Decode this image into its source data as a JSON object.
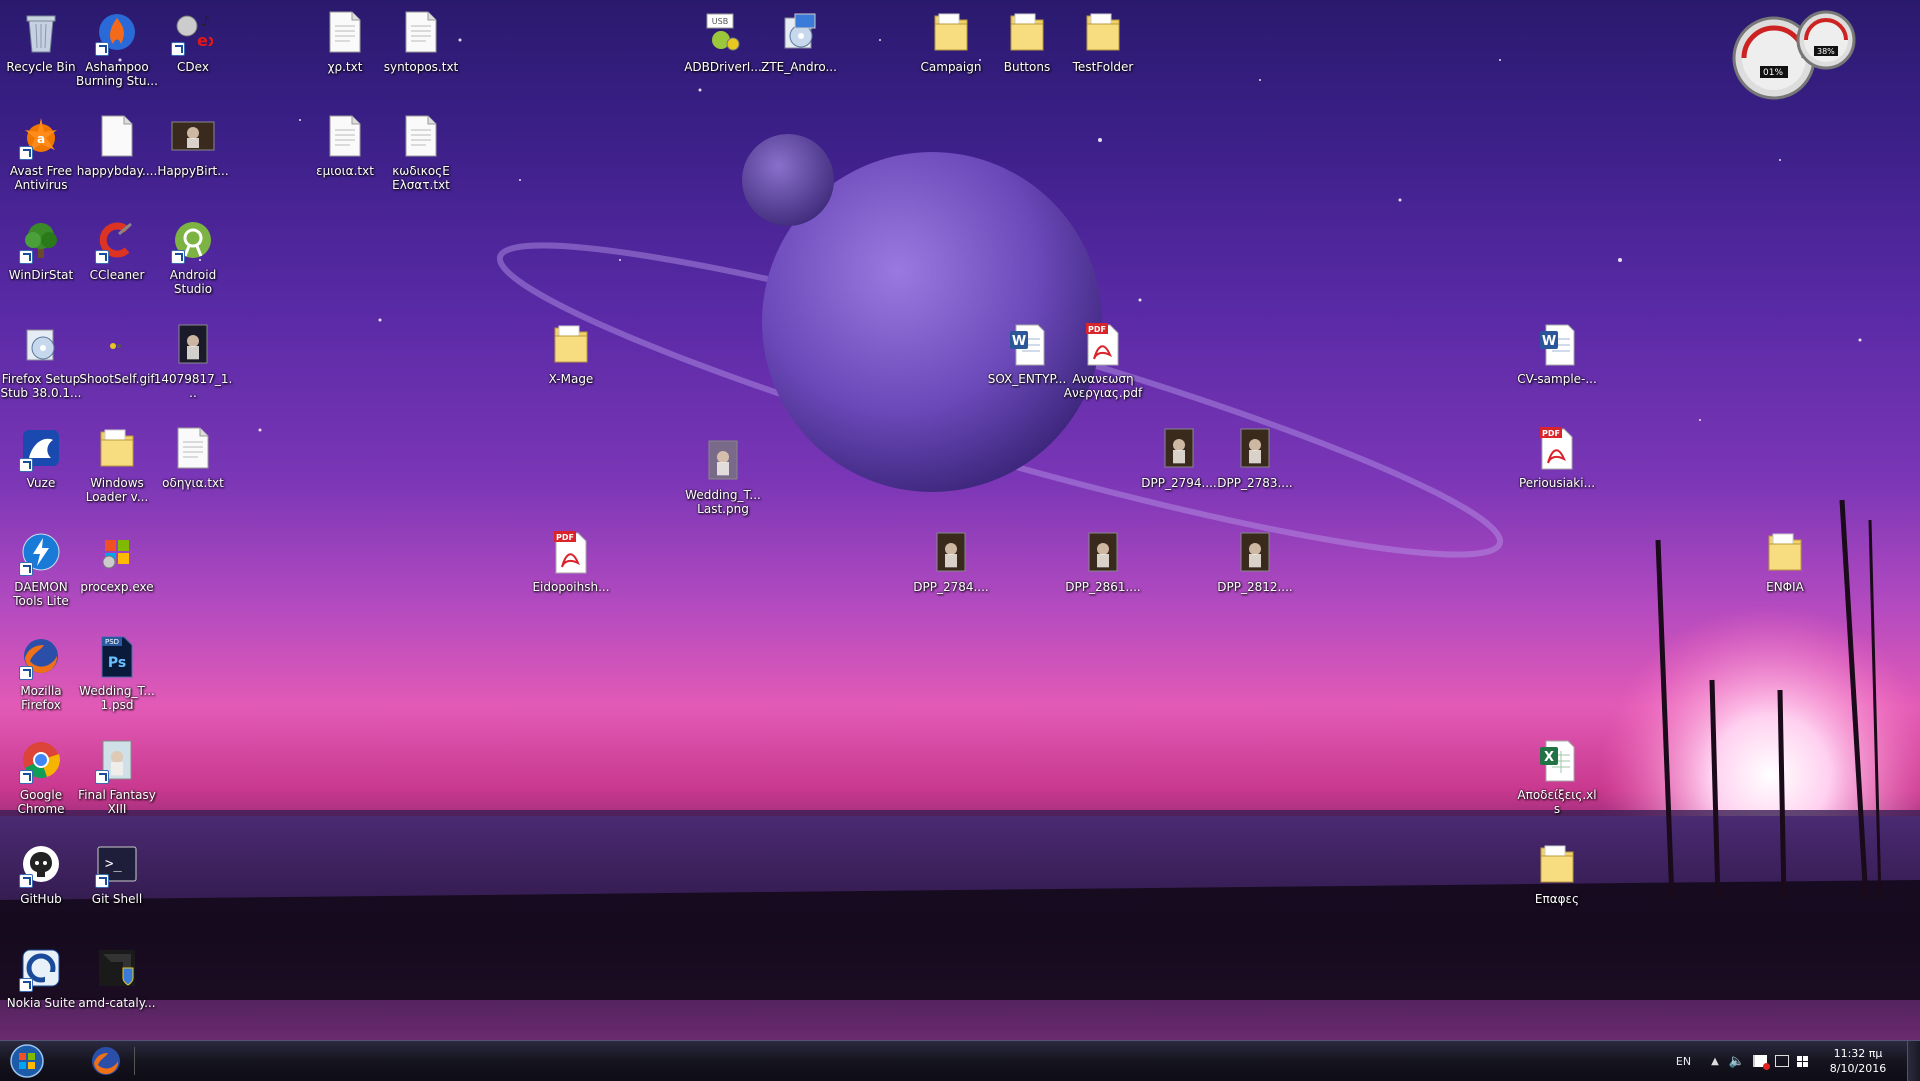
{
  "desktop": {
    "icons": [
      {
        "id": "recycle-bin",
        "label": "Recycle Bin",
        "icon": "recycle-bin-icon",
        "shortcut": false
      },
      {
        "id": "ashampoo",
        "label": "Ashampoo Burning Stu...",
        "icon": "ashampoo-flame-icon",
        "shortcut": true
      },
      {
        "id": "cdex",
        "label": "CDex",
        "icon": "cdex-icon",
        "shortcut": true
      },
      {
        "id": "xp-txt",
        "label": "χρ.txt",
        "icon": "text-file-icon",
        "shortcut": false
      },
      {
        "id": "syntopos-txt",
        "label": "syntopos.txt",
        "icon": "text-file-icon",
        "shortcut": false
      },
      {
        "id": "adbdriver",
        "label": "ADBDriverI...",
        "icon": "adb-usb-icon",
        "shortcut": false
      },
      {
        "id": "zte-android",
        "label": "ZTE_Andro...",
        "icon": "installer-icon",
        "shortcut": false
      },
      {
        "id": "campaign",
        "label": "Campaign",
        "icon": "folder-icon",
        "shortcut": false
      },
      {
        "id": "buttons",
        "label": "Buttons",
        "icon": "folder-icon",
        "shortcut": false
      },
      {
        "id": "testfolder",
        "label": "TestFolder",
        "icon": "folder-icon",
        "shortcut": false
      },
      {
        "id": "avast",
        "label": "Avast Free Antivirus",
        "icon": "avast-icon",
        "shortcut": true
      },
      {
        "id": "happybday",
        "label": "happybday....",
        "icon": "blank-file-icon",
        "shortcut": false
      },
      {
        "id": "happybirt",
        "label": "HappyBirt...",
        "icon": "image-thumbnail-icon",
        "shortcut": false
      },
      {
        "id": "emiona-txt",
        "label": "εμιοια.txt",
        "icon": "text-file-icon",
        "shortcut": false
      },
      {
        "id": "kodikos-txt",
        "label": "κωδικοςΕ Ελσατ.txt",
        "icon": "text-file-icon",
        "shortcut": false
      },
      {
        "id": "windirstat",
        "label": "WinDirStat",
        "icon": "windirstat-tree-icon",
        "shortcut": true
      },
      {
        "id": "ccleaner",
        "label": "CCleaner",
        "icon": "ccleaner-icon",
        "shortcut": true
      },
      {
        "id": "android-studio",
        "label": "Android Studio",
        "icon": "android-studio-icon",
        "shortcut": true
      },
      {
        "id": "firefox-setup",
        "label": "Firefox Setup Stub 38.0.1...",
        "icon": "installer-disc-icon",
        "shortcut": false
      },
      {
        "id": "shootself",
        "label": "ShootSelf.gif",
        "icon": "gif-thumbnail-icon",
        "shortcut": false
      },
      {
        "id": "img-14079817",
        "label": "14079817_1...",
        "icon": "dark-photo-thumbnail-icon",
        "shortcut": false
      },
      {
        "id": "x-mage",
        "label": "X-Mage",
        "icon": "folder-icon",
        "shortcut": false
      },
      {
        "id": "sox-entyp",
        "label": "SOX_ENTYP...",
        "icon": "word-doc-icon",
        "shortcut": false
      },
      {
        "id": "ananeosi-pdf",
        "label": "Ανανεωση Ανεργιας.pdf",
        "icon": "pdf-icon",
        "shortcut": false
      },
      {
        "id": "cv-sample",
        "label": "CV-sample-...",
        "icon": "word-doc-icon",
        "shortcut": false
      },
      {
        "id": "vuze",
        "label": "Vuze",
        "icon": "vuze-frog-icon",
        "shortcut": true
      },
      {
        "id": "windows-loader",
        "label": "Windows Loader v...",
        "icon": "folder-icon",
        "shortcut": false
      },
      {
        "id": "odigia-txt",
        "label": "οδηγια.txt",
        "icon": "text-file-icon",
        "shortcut": false
      },
      {
        "id": "wedding-last",
        "label": "Wedding_T... Last.png",
        "icon": "png-thumbnail-icon",
        "shortcut": false
      },
      {
        "id": "dpp-2794",
        "label": "DPP_2794....",
        "icon": "photo-thumbnail-icon",
        "shortcut": false
      },
      {
        "id": "dpp-2783",
        "label": "DPP_2783....",
        "icon": "photo-thumbnail-icon",
        "shortcut": false
      },
      {
        "id": "periousiaki",
        "label": "Periousiaki...",
        "icon": "pdf-icon",
        "shortcut": false
      },
      {
        "id": "daemon-tools",
        "label": "DAEMON Tools Lite",
        "icon": "daemon-tools-icon",
        "shortcut": true
      },
      {
        "id": "procexp",
        "label": "procexp.exe",
        "icon": "windows-flag-icon",
        "shortcut": false
      },
      {
        "id": "eidopoihsh",
        "label": "Eidopoihsh...",
        "icon": "pdf-icon",
        "shortcut": false
      },
      {
        "id": "dpp-2784",
        "label": "DPP_2784....",
        "icon": "photo-thumbnail-icon",
        "shortcut": false
      },
      {
        "id": "dpp-2861",
        "label": "DPP_2861....",
        "icon": "photo-thumbnail-icon",
        "shortcut": false
      },
      {
        "id": "dpp-2812",
        "label": "DPP_2812....",
        "icon": "photo-thumbnail-icon",
        "shortcut": false
      },
      {
        "id": "enfia",
        "label": "ΕΝΦΙΑ",
        "icon": "folder-icon",
        "shortcut": false
      },
      {
        "id": "firefox",
        "label": "Mozilla Firefox",
        "icon": "firefox-icon",
        "shortcut": true
      },
      {
        "id": "wedding-psd",
        "label": "Wedding_T... 1.psd",
        "icon": "photoshop-psd-icon",
        "shortcut": false
      },
      {
        "id": "chrome",
        "label": "Google Chrome",
        "icon": "chrome-icon",
        "shortcut": true
      },
      {
        "id": "ffxiii",
        "label": "Final Fantasy XIII",
        "icon": "game-thumbnail-icon",
        "shortcut": true
      },
      {
        "id": "apodeixeis",
        "label": "Αποδείξεις.xls",
        "icon": "excel-icon",
        "shortcut": false
      },
      {
        "id": "github",
        "label": "GitHub",
        "icon": "github-octocat-icon",
        "shortcut": true
      },
      {
        "id": "git-shell",
        "label": "Git Shell",
        "icon": "terminal-icon",
        "shortcut": true
      },
      {
        "id": "epafes",
        "label": "Επαφες",
        "icon": "folder-icon",
        "shortcut": false
      },
      {
        "id": "nokia-suite",
        "label": "Nokia Suite",
        "icon": "nokia-suite-icon",
        "shortcut": true
      },
      {
        "id": "amd-catalyst",
        "label": "amd-cataly...",
        "icon": "amd-shield-icon",
        "shortcut": false
      }
    ],
    "gadget": {
      "cpu": "01%",
      "memory": "38%"
    }
  },
  "taskbar": {
    "pinned": [
      {
        "name": "firefox",
        "icon": "firefox-icon"
      }
    ],
    "tray": {
      "language": "EN",
      "time": "11:32 πμ",
      "date": "8/10/2016"
    }
  },
  "colors": {
    "folder": "#f2d36b",
    "pdf": "#d8242a",
    "word": "#2b579a",
    "excel": "#217346",
    "taskbar": "#15141f"
  }
}
